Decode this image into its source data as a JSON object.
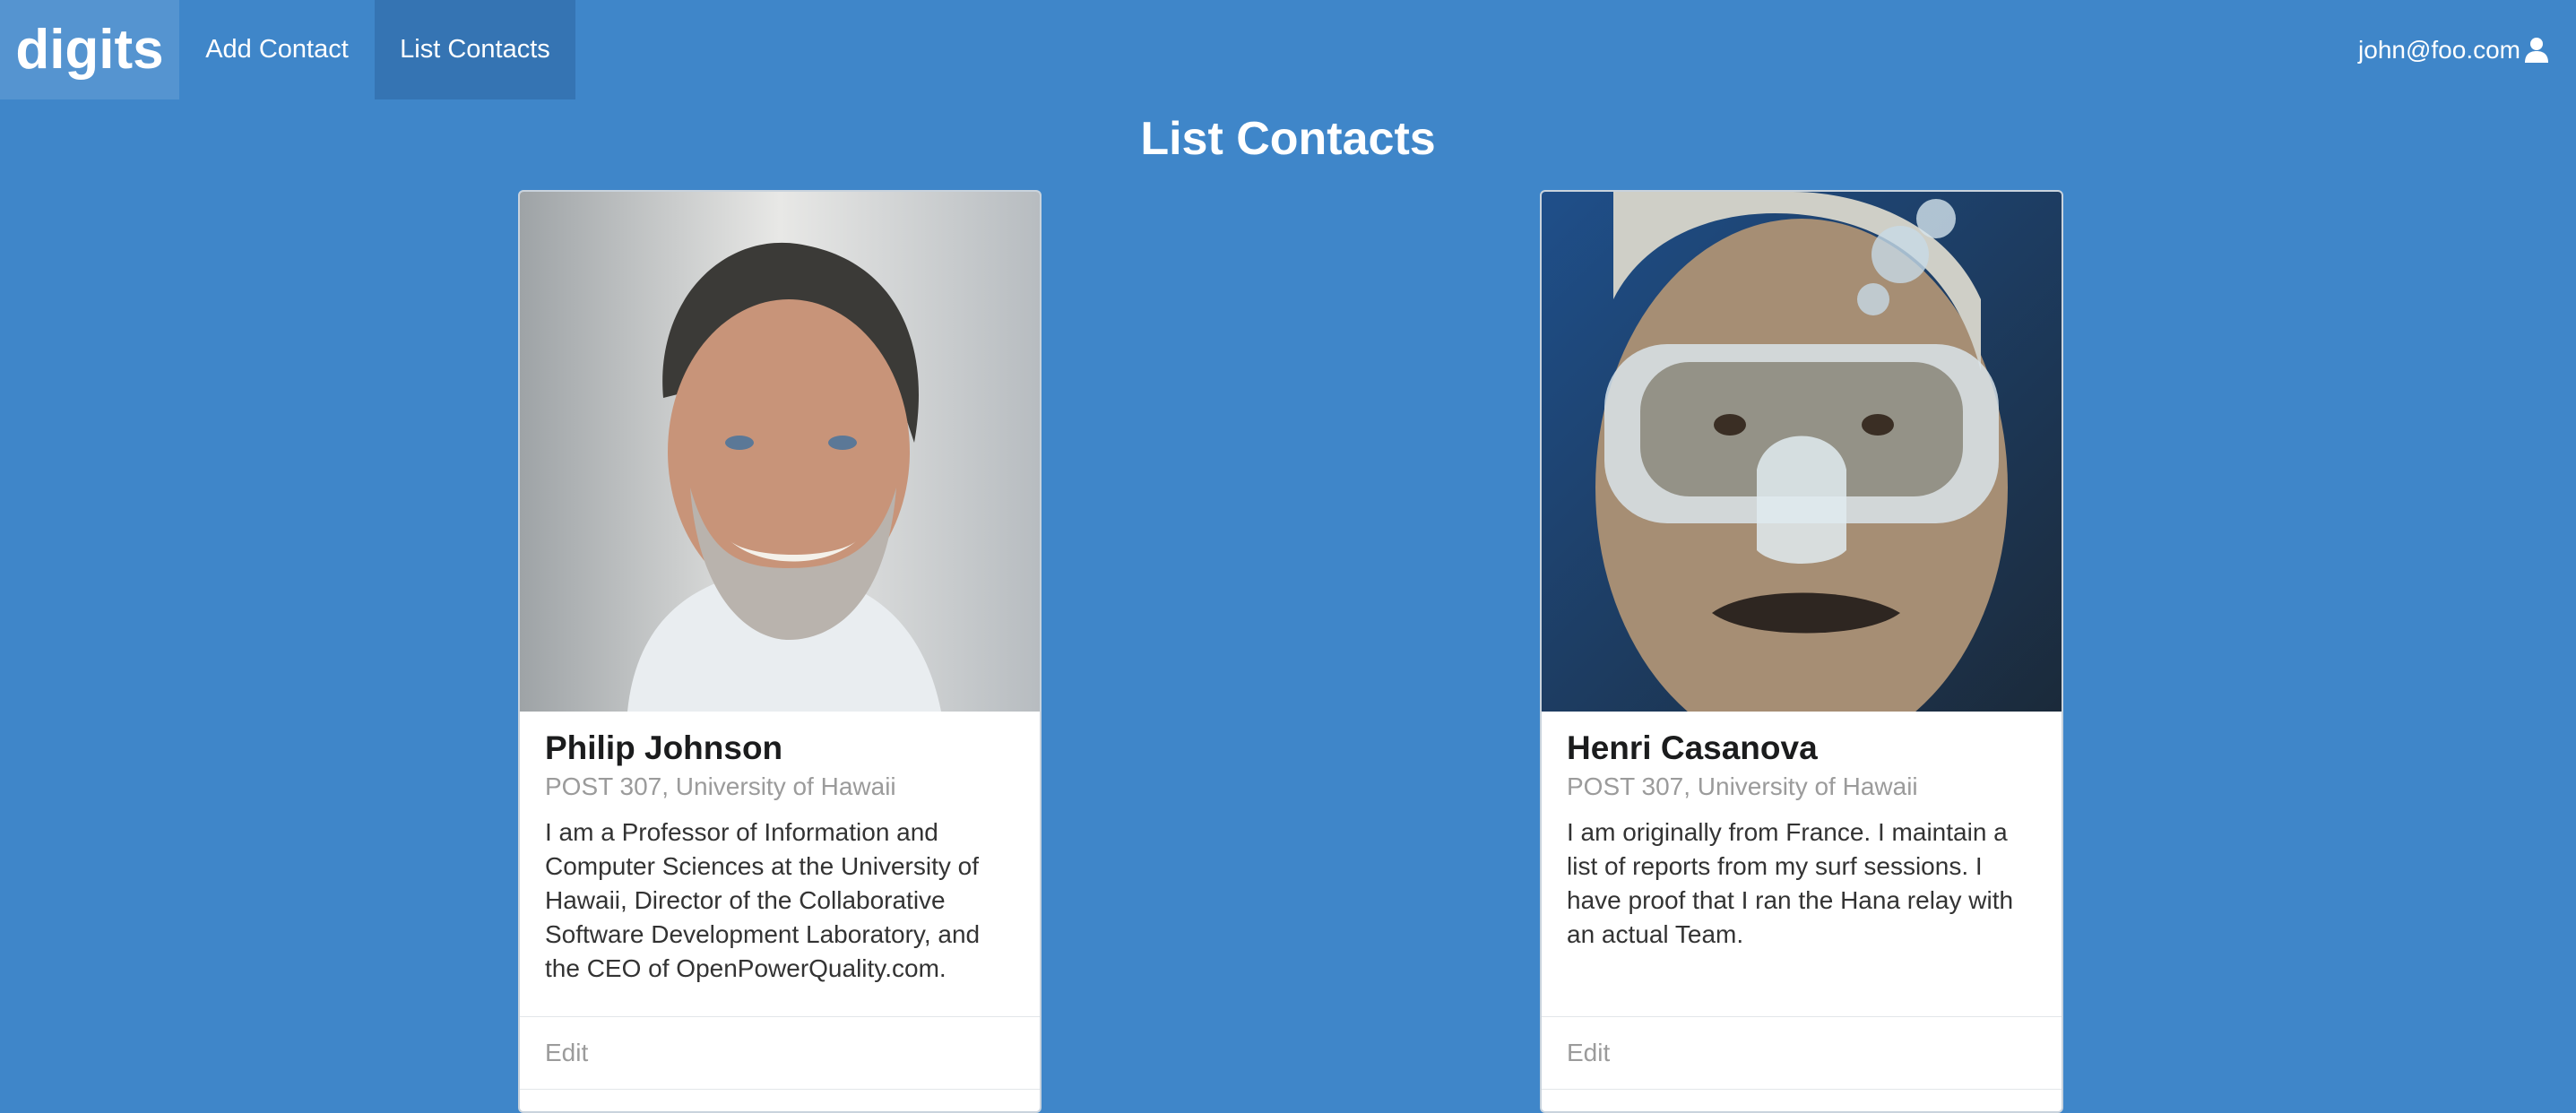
{
  "navbar": {
    "brand": "digits",
    "items": [
      {
        "label": "Add Contact",
        "active": false
      },
      {
        "label": "List Contacts",
        "active": true
      }
    ],
    "user_email": "john@foo.com",
    "user_icon": "user-icon"
  },
  "page": {
    "title": "List Contacts"
  },
  "contacts": [
    {
      "name": "Philip Johnson",
      "address": "POST 307, University of Hawaii",
      "description": "I am a Professor of Information and Computer Sciences at the University of Hawaii, Director of the Collaborative Software Development Laboratory, and the CEO of OpenPowerQuality.com.",
      "edit_label": "Edit"
    },
    {
      "name": "Henri Casanova",
      "address": "POST 307, University of Hawaii",
      "description": "I am originally from France. I maintain a list of reports from my surf sessions. I have proof that I ran the Hana relay with an actual Team.",
      "edit_label": "Edit"
    }
  ],
  "colors": {
    "background": "#3f86c9",
    "brand_bg": "#5594d0",
    "active_nav_bg": "#3574b3"
  }
}
